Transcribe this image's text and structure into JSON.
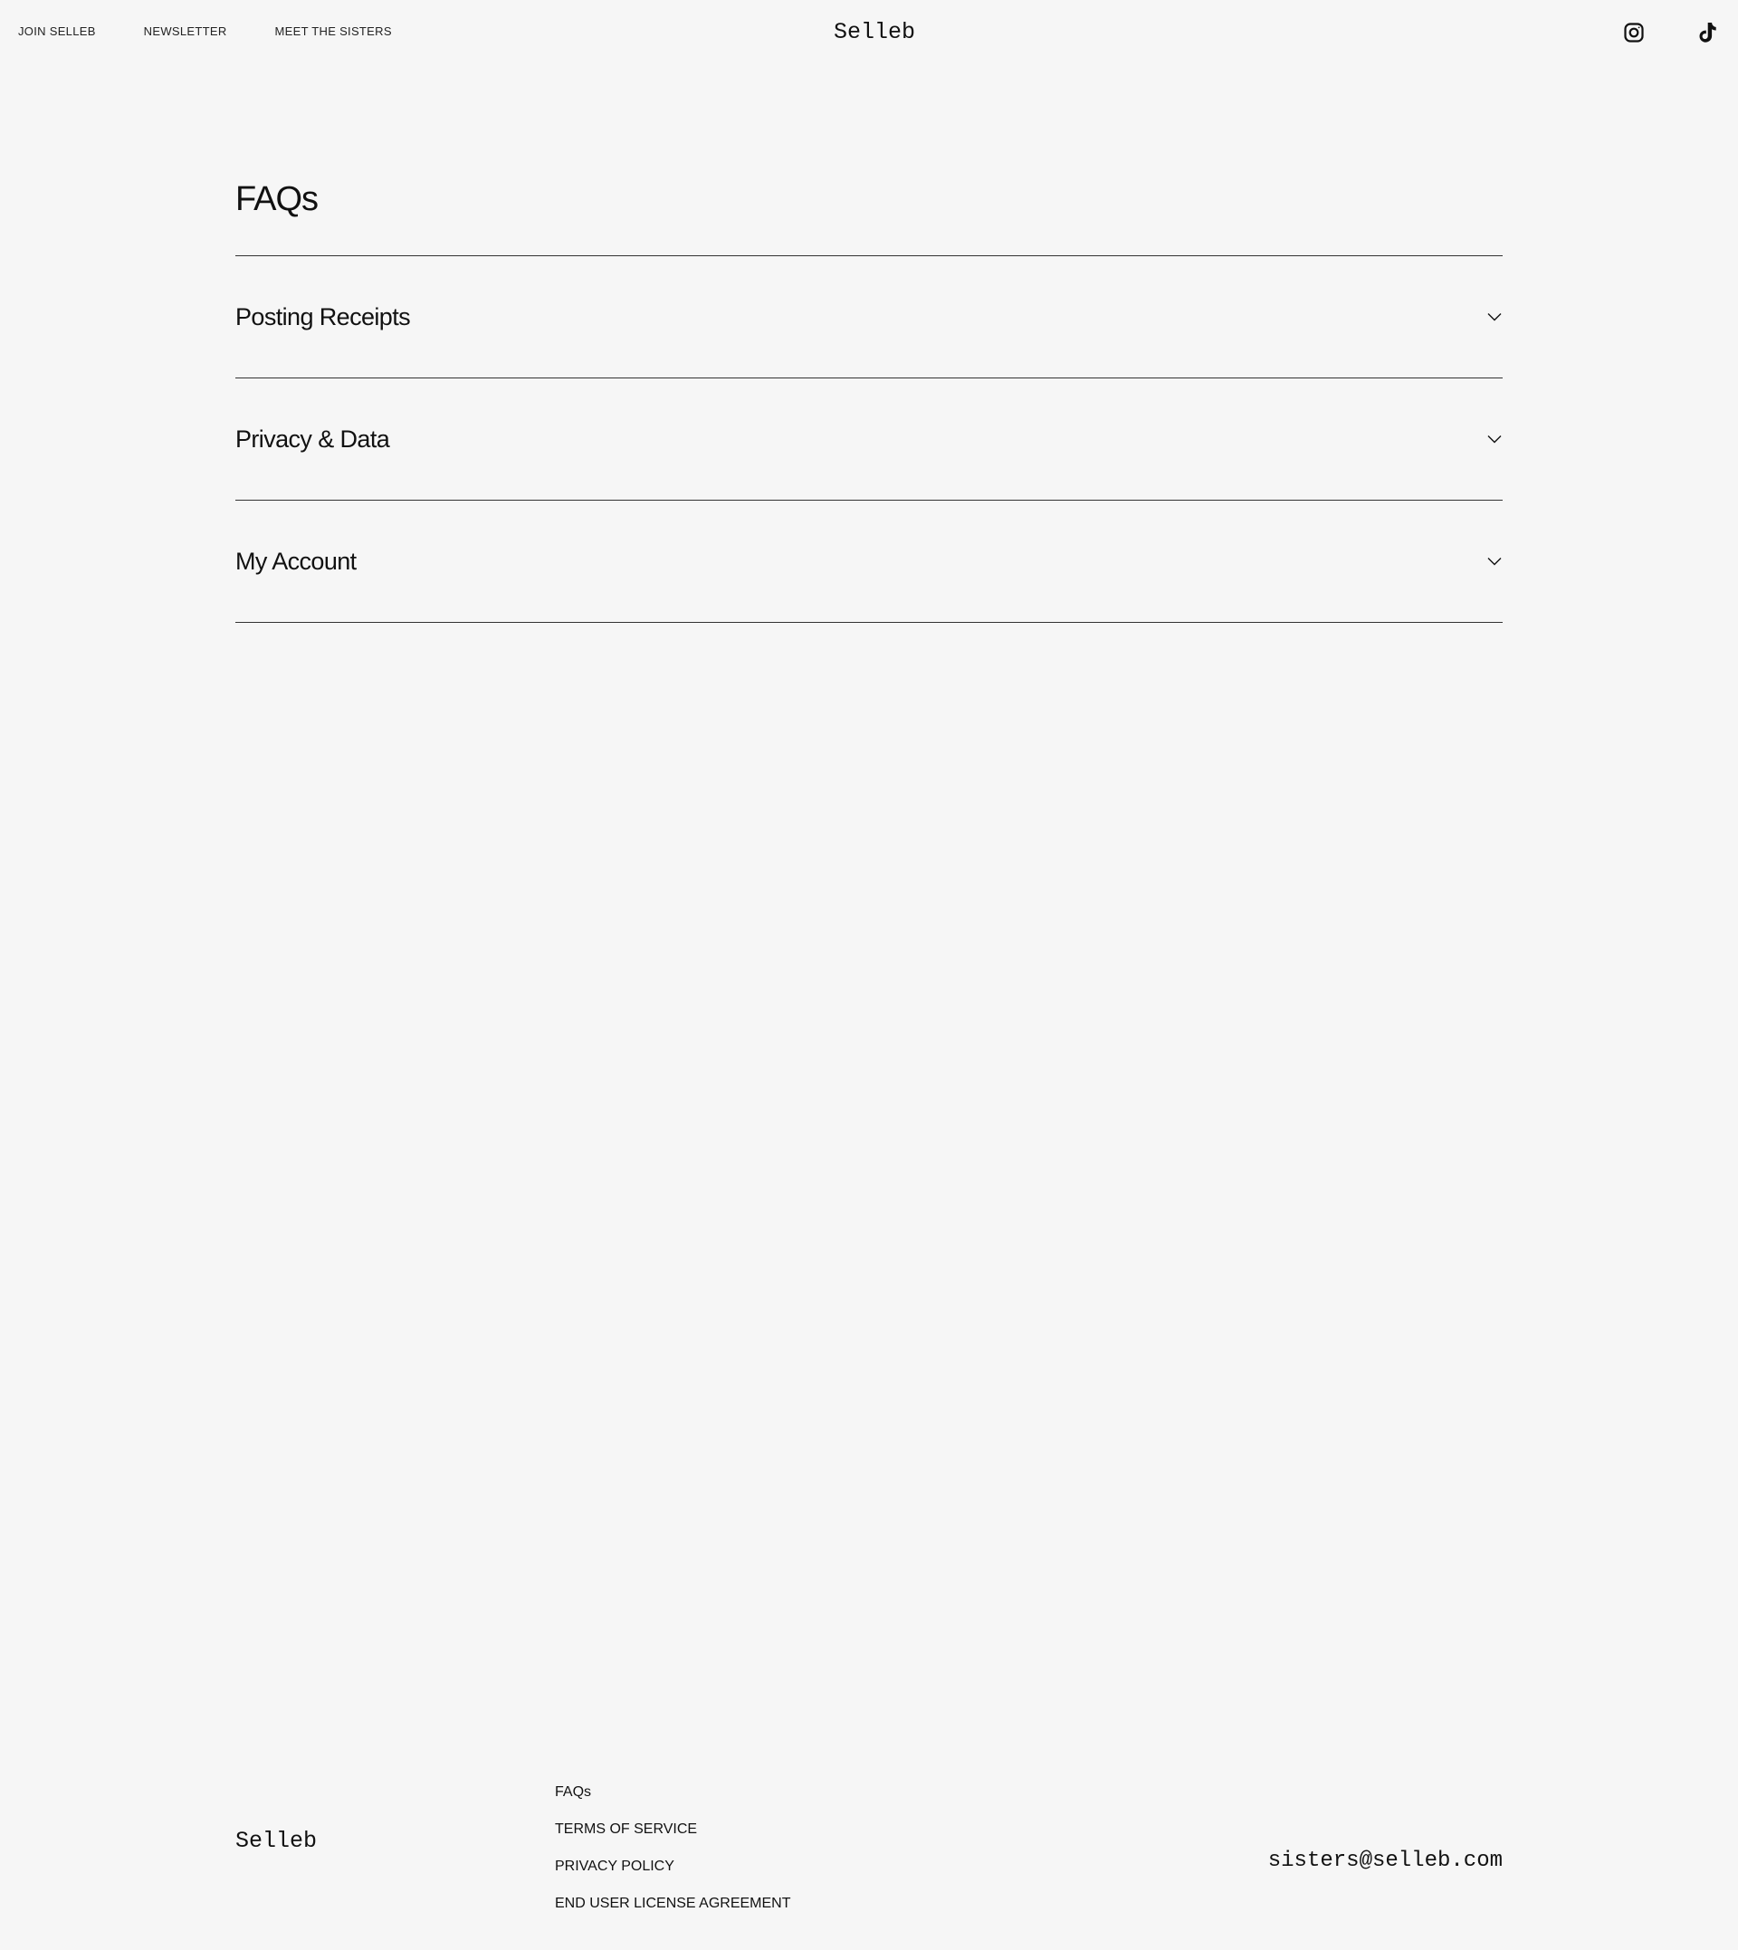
{
  "header": {
    "nav": [
      {
        "label": "JOIN SELLEB"
      },
      {
        "label": "NEWSLETTER"
      },
      {
        "label": "MEET THE SISTERS"
      }
    ],
    "brand": "Selleb",
    "social": [
      {
        "icon": "instagram-icon"
      },
      {
        "icon": "tiktok-icon"
      }
    ]
  },
  "main": {
    "title": "FAQs",
    "sections": [
      {
        "label": "Posting Receipts",
        "icon": "chevron-down-icon"
      },
      {
        "label": "Privacy & Data",
        "icon": "chevron-down-icon"
      },
      {
        "label": "My Account",
        "icon": "chevron-down-icon"
      }
    ]
  },
  "footer": {
    "brand": "Selleb",
    "links": [
      {
        "label": "FAQs"
      },
      {
        "label": "TERMS OF SERVICE"
      },
      {
        "label": "PRIVACY POLICY"
      },
      {
        "label": "END USER LICENSE AGREEMENT"
      }
    ],
    "email": "sisters@selleb.com"
  },
  "colors": {
    "background": "#f6f6f6",
    "text": "#111111",
    "divider": "#333333"
  }
}
